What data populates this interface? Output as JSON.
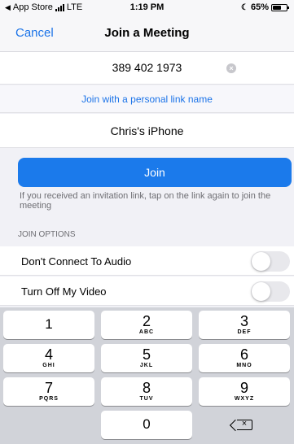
{
  "status_bar": {
    "back_app": "App Store",
    "network": "LTE",
    "time": "1:19 PM",
    "battery": "65%",
    "battery_level": 0.65
  },
  "nav": {
    "cancel_label": "Cancel",
    "title": "Join a Meeting"
  },
  "meeting_id": {
    "value": "389 402 1973",
    "clear_symbol": "×"
  },
  "personal_link": "Join with a personal link name",
  "display_name": "Chris's iPhone",
  "join_label": "Join",
  "hint": "If you received an invitation link, tap on the link again to join the meeting",
  "join_options": {
    "header": "JOIN OPTIONS",
    "items": [
      {
        "label": "Don't Connect To Audio",
        "on": false
      },
      {
        "label": "Turn Off My Video",
        "on": false
      }
    ]
  },
  "keypad": {
    "keys": [
      {
        "digit": "1",
        "letters": ""
      },
      {
        "digit": "2",
        "letters": "ABC"
      },
      {
        "digit": "3",
        "letters": "DEF"
      },
      {
        "digit": "4",
        "letters": "GHI"
      },
      {
        "digit": "5",
        "letters": "JKL"
      },
      {
        "digit": "6",
        "letters": "MNO"
      },
      {
        "digit": "7",
        "letters": "PQRS"
      },
      {
        "digit": "8",
        "letters": "TUV"
      },
      {
        "digit": "9",
        "letters": "WXYZ"
      },
      {
        "digit": "0",
        "letters": ""
      }
    ],
    "delete_icon": "backspace-icon",
    "delete_symbol": "×"
  },
  "colors": {
    "accent": "#1b73e8",
    "join_button": "#1b7aeb",
    "keypad_bg": "#d1d3d9"
  }
}
